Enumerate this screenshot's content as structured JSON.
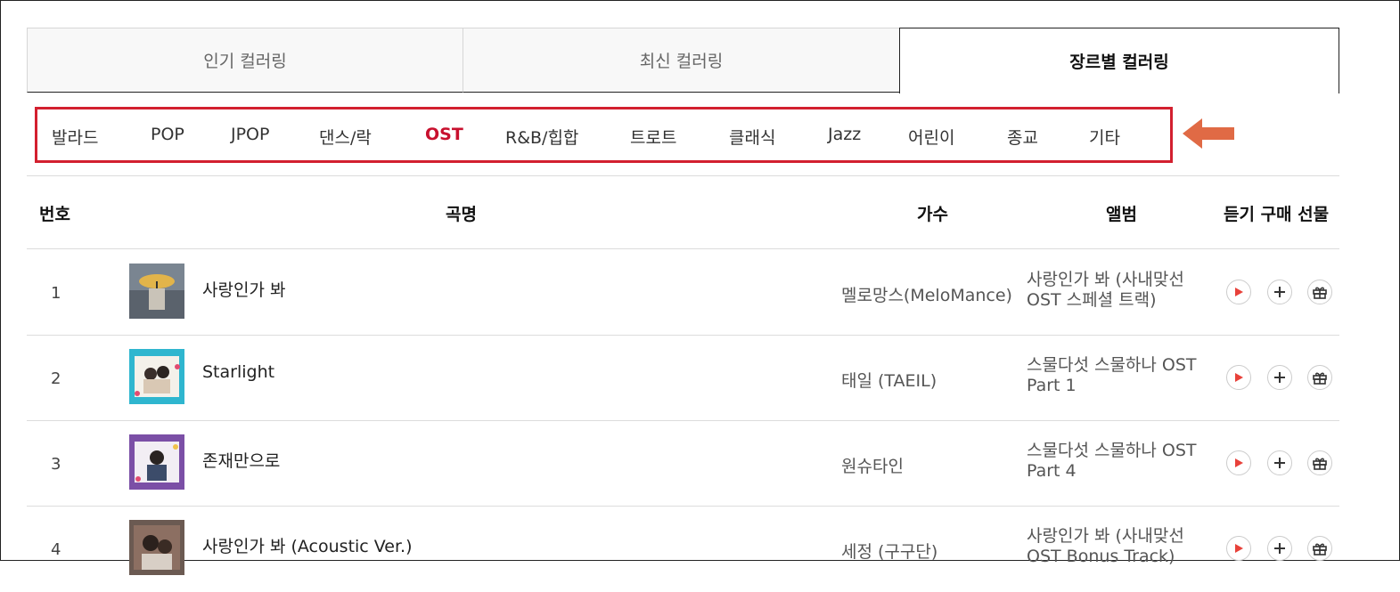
{
  "tabs": [
    "인기 컬러링",
    "최신 컬러링",
    "장르별 컬러링"
  ],
  "genres": [
    "발라드",
    "POP",
    "JPOP",
    "댄스/락",
    "OST",
    "R&B/힙합",
    "트로트",
    "클래식",
    "Jazz",
    "어린이",
    "종교",
    "기타"
  ],
  "active_genre": "OST",
  "headers": {
    "rank": "번호",
    "title": "곡명",
    "artist": "가수",
    "album": "앨범",
    "actions": "듣기 구매 선물"
  },
  "rows": [
    {
      "rank": "1",
      "title": "사랑인가 봐",
      "artist": "멜로망스(MeloMance)",
      "album": "사랑인가 봐 (사내맞선 OST 스페셜 트랙)"
    },
    {
      "rank": "2",
      "title": "Starlight",
      "artist": "태일 (TAEIL)",
      "album": "스물다섯 스물하나 OST Part 1"
    },
    {
      "rank": "3",
      "title": "존재만으로",
      "artist": "원슈타인",
      "album": "스물다섯 스물하나 OST Part 4"
    },
    {
      "rank": "4",
      "title": "사랑인가 봐 (Acoustic Ver.)",
      "artist": "세정 (구구단)",
      "album": "사랑인가 봐 (사내맞선 OST Bonus Track)"
    }
  ],
  "icons": {
    "play": "play-icon",
    "add": "plus-icon",
    "gift": "gift-icon",
    "arrow": "left-arrow-icon"
  },
  "colors": {
    "accent": "#c8102e",
    "highlight_box": "#d3202f",
    "arrow": "#e06a45",
    "play": "#e8413a"
  }
}
